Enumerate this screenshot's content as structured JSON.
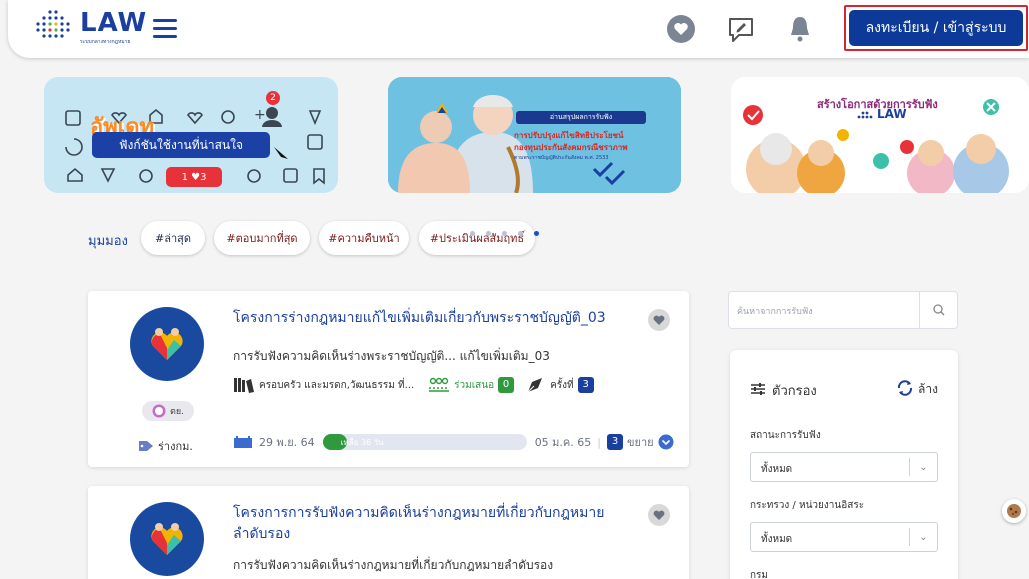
{
  "header": {
    "logo_text": "LAW",
    "logo_tagline": "ระบบกลางทางกฎหมาย",
    "login_label": "ลงทะเบียน / เข้าสู่ระบบ"
  },
  "banners": {
    "b1": {
      "promo": "อัพเดท",
      "pill": "ฟังก์ชันใช้งานที่น่าสนใจ",
      "badge": "1 ♥3",
      "notif": "2"
    },
    "b2": {
      "heading": "อ่านสรุปผลการรับฟัง",
      "line1": "การปรับปรุงแก้ไขสิทธิประโยชน์",
      "line2": "กองทุนประกันสังคมกรณีชราภาพ",
      "line3": "ตามพระราชบัญญัติประกันสังคม พ.ศ. 2533"
    },
    "b3": {
      "heading": "สร้างโอกาสด้วยการรับฟัง",
      "logo": "LAW"
    }
  },
  "topics": {
    "label": "มุมมอง",
    "chips": [
      "#ล่าสุด",
      "#ตอบมากที่สุด",
      "#ความคืบหน้า",
      "#ประเมินผลสัมฤทธิ์"
    ]
  },
  "cards": [
    {
      "title": "โครงการร่างกฎหมายแก้ไขเพิ่มเติมเกี่ยวกับพระราชบัญญัติ_03",
      "desc": "การรับฟังความคิดเห็นร่างพระราชบัญญัติ... แก้ไขเพิ่มเติม_03",
      "category": "ครอบครัว และมรดก,วัฒนธรรม ที่...",
      "join_label": "ร่วมเสนอ",
      "join_count": "0",
      "round_label": "ครั้งที่",
      "round_count": "3",
      "org": "ตย.",
      "tag": "ร่างกม.",
      "start": "29 พ.ย. 64",
      "remain": "เหลือ 36 วัน",
      "end": "05 ม.ค. 65",
      "extend_count": "3",
      "extend_label": "ขยาย",
      "progress": 0.12
    },
    {
      "title": "โครงการการรับฟังความคิดเห็นร่างกฎหมายที่เกี่ยวกับกฎหมายลำดับรอง",
      "desc": "การรับฟังความคิดเห็นร่างกฎหมายที่เกี่ยวกับกฎหมายลำดับรอง"
    }
  ],
  "sidebar": {
    "search_placeholder": "ค้นหาจากการรับฟัง",
    "filter_title": "ตัวกรอง",
    "clear_label": "ล้าง",
    "status_label": "สถานะการรับฟัง",
    "status_value": "ทั้งหมด",
    "ministry_label": "กระทรวง / หน่วยงานอิสระ",
    "ministry_value": "ทั้งหมด",
    "dept_label": "กรม"
  },
  "colors": {
    "brand": "#1a3f9e",
    "login_border": "#d8262f",
    "accent_green": "#2f9a3c"
  }
}
